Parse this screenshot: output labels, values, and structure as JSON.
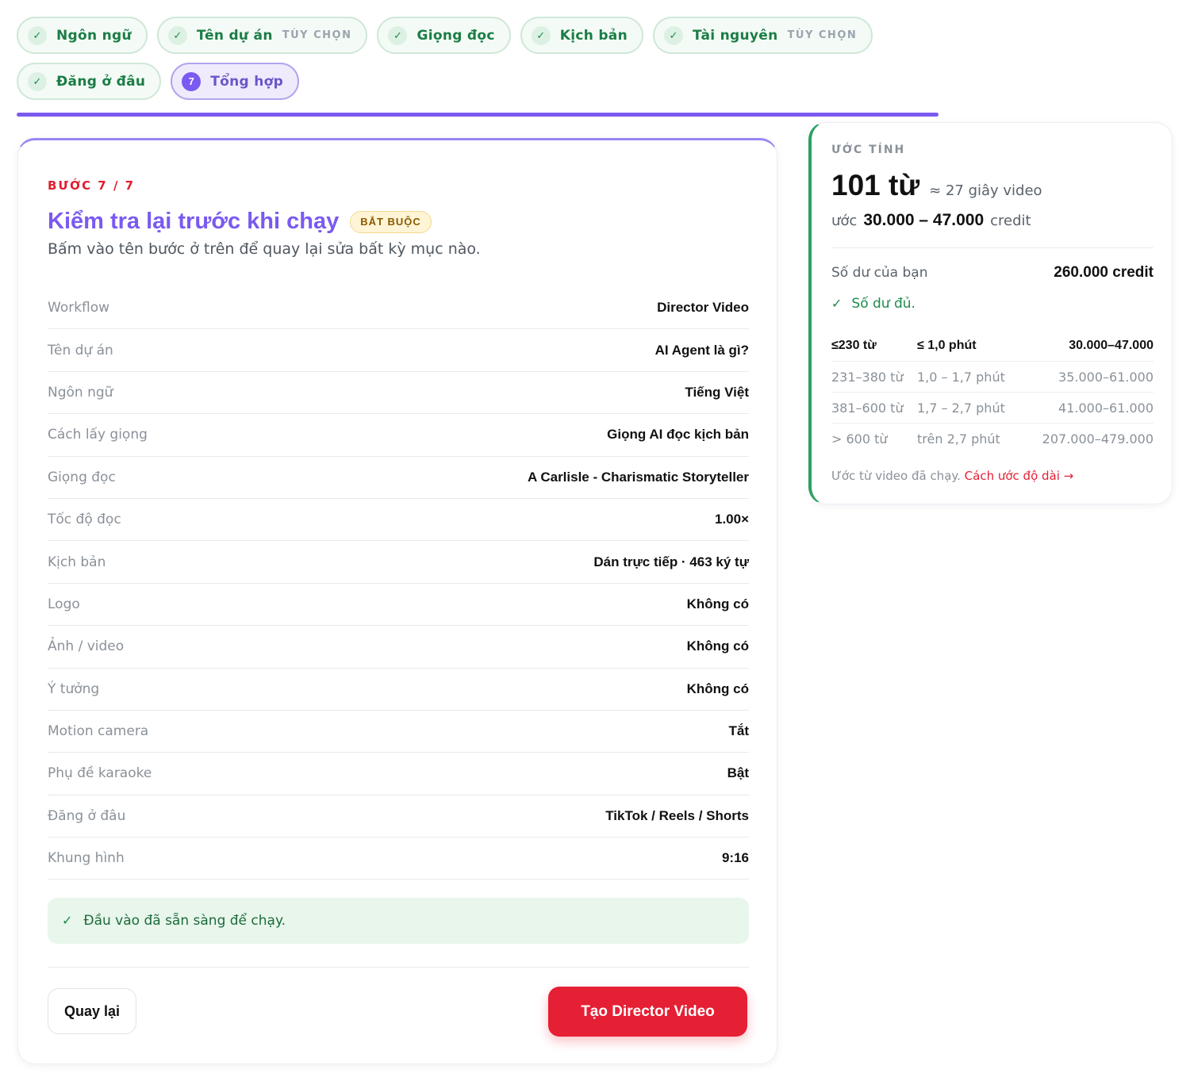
{
  "stepper": {
    "steps": [
      {
        "label": "Ngôn ngữ",
        "optional": ""
      },
      {
        "label": "Tên dự án",
        "optional": "TÙY CHỌN"
      },
      {
        "label": "Giọng đọc",
        "optional": ""
      },
      {
        "label": "Kịch bản",
        "optional": ""
      },
      {
        "label": "Tài nguyên",
        "optional": "TÙY CHỌN"
      },
      {
        "label": "Đăng ở đâu",
        "optional": ""
      },
      {
        "label": "Tổng hợp",
        "number": "7"
      }
    ],
    "progress_fraction": 1.0
  },
  "main": {
    "step_count": "BƯỚC 7 / 7",
    "title": "Kiểm tra lại trước khi chạy",
    "badge": "BẮT BUỘC",
    "subtitle": "Bấm vào tên bước ở trên để quay lại sửa bất kỳ mục nào.",
    "summary": [
      {
        "key": "Workflow",
        "value": "Director Video"
      },
      {
        "key": "Tên dự án",
        "value": "AI Agent là gì?"
      },
      {
        "key": "Ngôn ngữ",
        "value": "Tiếng Việt"
      },
      {
        "key": "Cách lấy giọng",
        "value": "Giọng AI đọc kịch bản"
      },
      {
        "key": "Giọng đọc",
        "value": "A Carlisle - Charismatic Storyteller"
      },
      {
        "key": "Tốc độ đọc",
        "value": "1.00×"
      },
      {
        "key": "Kịch bản",
        "value": "Dán trực tiếp · 463 ký tự"
      },
      {
        "key": "Logo",
        "value": "Không có"
      },
      {
        "key": "Ảnh / video",
        "value": "Không có"
      },
      {
        "key": "Ý tưởng",
        "value": "Không có"
      },
      {
        "key": "Motion camera",
        "value": "Tắt"
      },
      {
        "key": "Phụ đề karaoke",
        "value": "Bật"
      },
      {
        "key": "Đăng ở đâu",
        "value": "TikTok / Reels / Shorts"
      },
      {
        "key": "Khung hình",
        "value": "9:16"
      }
    ],
    "ready_text": "Đầu vào đã sẵn sàng để chạy.",
    "back_label": "Quay lại",
    "create_label": "Tạo Director Video"
  },
  "estimate": {
    "heading": "ƯỚC TÍNH",
    "words": "101 từ",
    "seconds": "≈ 27 giây video",
    "credit_prefix": "ước",
    "credit_range": "30.000 – 47.000",
    "credit_unit": "credit",
    "balance_label": "Số dư của bạn",
    "balance_value": "260.000 credit",
    "balance_ok": "Số dư đủ.",
    "tiers": [
      {
        "words": "≤230 từ",
        "duration": "≤ 1,0 phút",
        "credit": "30.000–47.000"
      },
      {
        "words": "231–380 từ",
        "duration": "1,0 – 1,7 phút",
        "credit": "35.000–61.000"
      },
      {
        "words": "381–600 từ",
        "duration": "1,7 – 2,7 phút",
        "credit": "41.000–61.000"
      },
      {
        "words": "> 600 từ",
        "duration": "trên 2,7 phút",
        "credit": "207.000–479.000"
      }
    ],
    "footer_note": "Ước từ video đã chạy.",
    "footer_link": "Cách ước độ dài →"
  },
  "colors": {
    "accent": "#7a5af0",
    "success": "#1f8a4c",
    "danger": "#e51f34"
  }
}
